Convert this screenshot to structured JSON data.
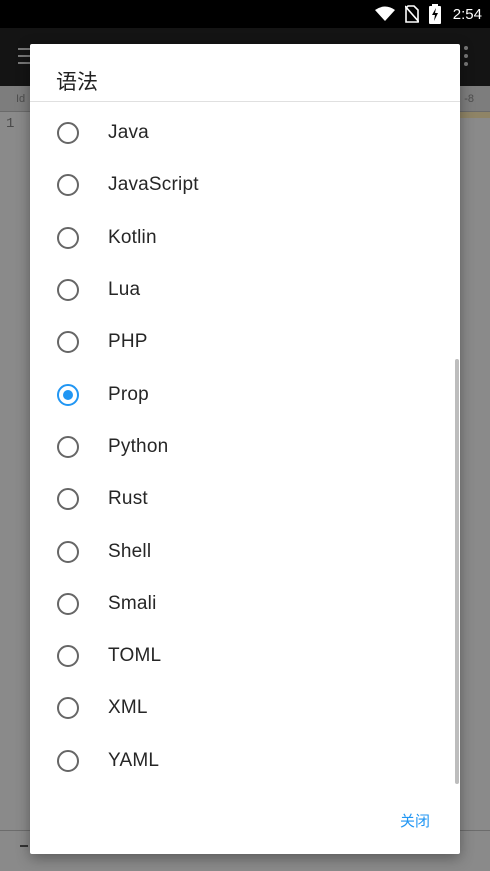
{
  "status_bar": {
    "time": "2:54",
    "icons": [
      "wifi-icon",
      "no-sim-icon",
      "battery-charging-icon"
    ]
  },
  "background_app": {
    "tab_left": "Id",
    "tab_right": "-8",
    "line_number": "1"
  },
  "dialog": {
    "title": "语法",
    "selected": "Prop",
    "options": [
      {
        "label": "Java",
        "checked": false
      },
      {
        "label": "JavaScript",
        "checked": false
      },
      {
        "label": "Kotlin",
        "checked": false
      },
      {
        "label": "Lua",
        "checked": false
      },
      {
        "label": "PHP",
        "checked": false
      },
      {
        "label": "Prop",
        "checked": true
      },
      {
        "label": "Python",
        "checked": false
      },
      {
        "label": "Rust",
        "checked": false
      },
      {
        "label": "Shell",
        "checked": false
      },
      {
        "label": "Smali",
        "checked": false
      },
      {
        "label": "TOML",
        "checked": false
      },
      {
        "label": "XML",
        "checked": false
      },
      {
        "label": "YAML",
        "checked": false
      }
    ],
    "close_label": "关闭"
  },
  "colors": {
    "accent": "#2196f3",
    "radio_unchecked": "#666666",
    "scrim": "#8a8a8a"
  }
}
